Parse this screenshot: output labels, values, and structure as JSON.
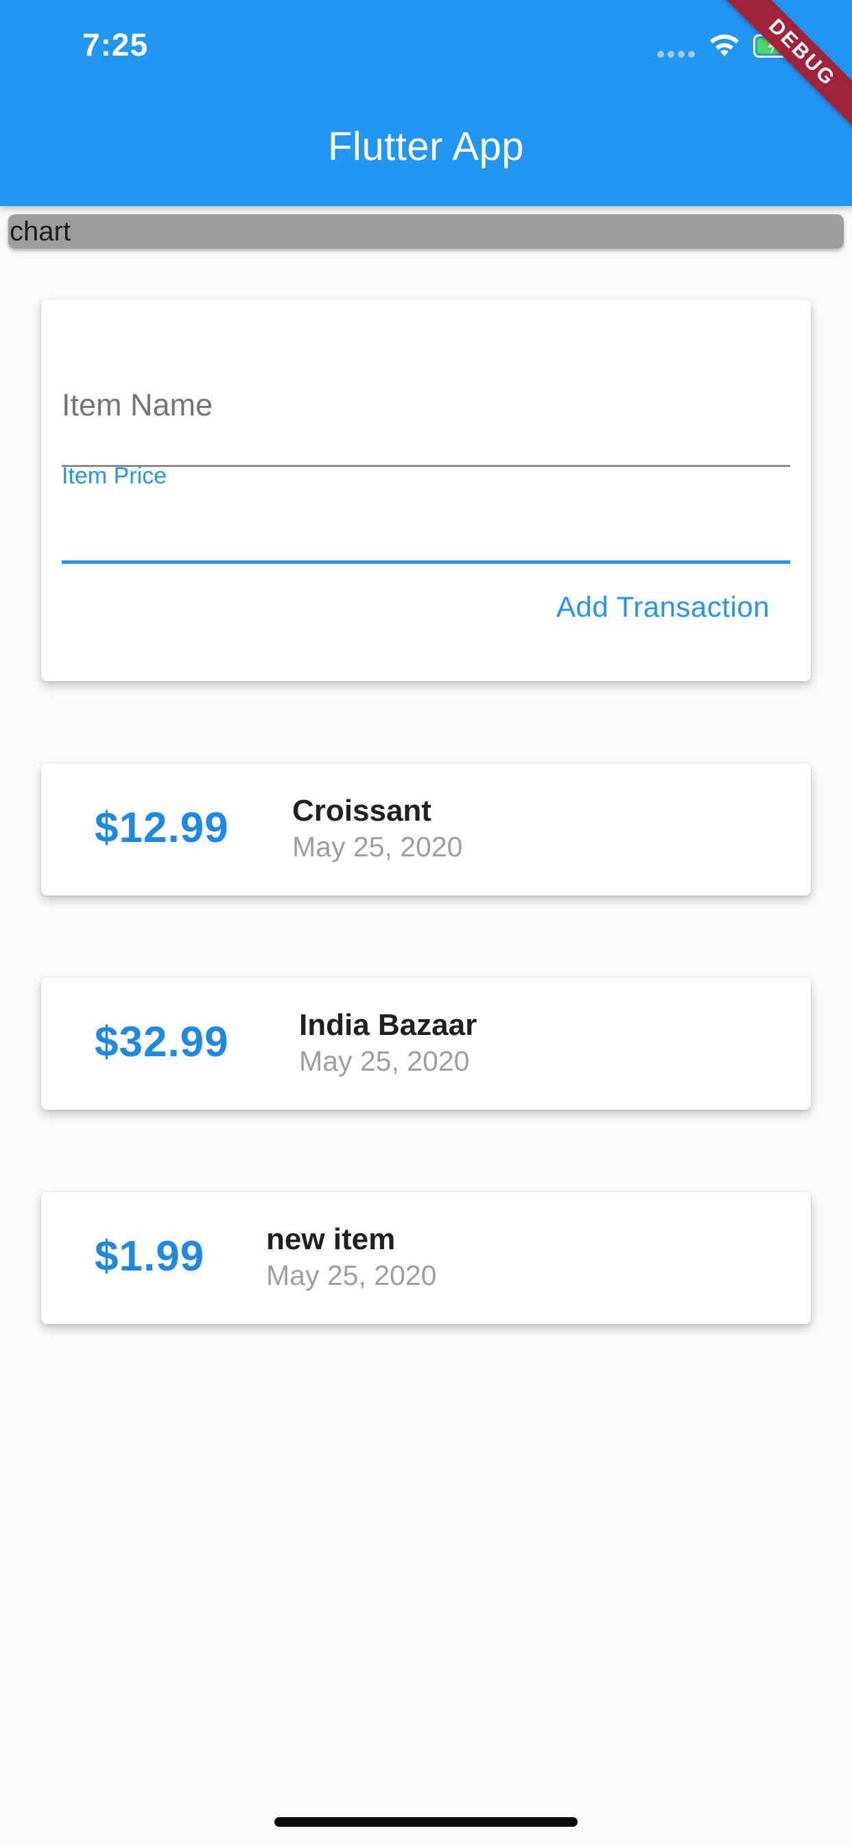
{
  "status_bar": {
    "time": "7:25",
    "icons": [
      "signal-icon",
      "wifi-icon",
      "battery-charging-icon"
    ]
  },
  "app_bar": {
    "title": "Flutter App",
    "debug_banner": "DEBUG",
    "color": "#2196f3"
  },
  "chart": {
    "label": "chart"
  },
  "form": {
    "name_placeholder": "Item Name",
    "price_label": "Item Price",
    "submit_label": "Add Transaction"
  },
  "transactions": [
    {
      "amount": "$12.99",
      "title": "Croissant",
      "date": "May 25, 2020"
    },
    {
      "amount": "$32.99",
      "title": "India Bazaar",
      "date": "May 25, 2020"
    },
    {
      "amount": "$1.99",
      "title": "new item",
      "date": "May 25, 2020"
    }
  ],
  "colors": {
    "accent": "#2196f3",
    "amount": "#1e88e5",
    "background": "#fafafa",
    "chart_placeholder": "#9e9e9e",
    "debug_banner": "#a0233a"
  }
}
